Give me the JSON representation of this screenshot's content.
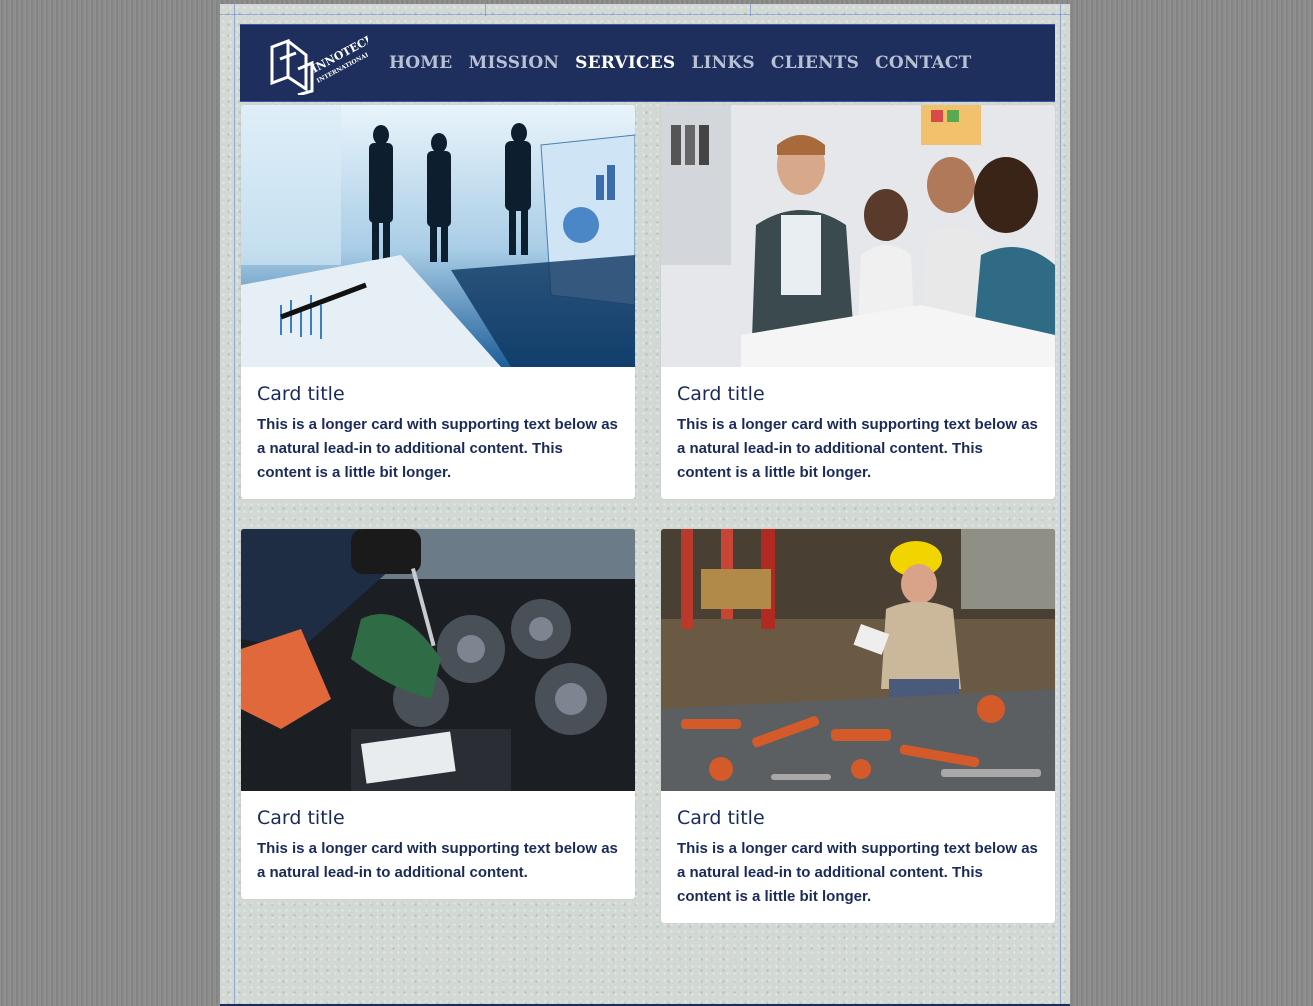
{
  "brand": {
    "logo_text": "INNOTECH",
    "logo_subtext": "INTERNATIONAL, LLC"
  },
  "nav": {
    "items": [
      {
        "label": "HOME",
        "active": false
      },
      {
        "label": "MISSION",
        "active": false
      },
      {
        "label": "SERVICES",
        "active": true
      },
      {
        "label": "LINKS",
        "active": false
      },
      {
        "label": "CLIENTS",
        "active": false
      },
      {
        "label": "CONTACT",
        "active": false
      }
    ]
  },
  "cards": [
    {
      "image": "business-meeting-photo",
      "title": "Card title",
      "text": "This is a longer card with supporting text below as a natural lead-in to additional content. This content is a little bit longer."
    },
    {
      "image": "team-discussion-photo",
      "title": "Card title",
      "text": "This is a longer card with supporting text below as a natural lead-in to additional content. This content is a little bit longer."
    },
    {
      "image": "engine-repair-photo",
      "title": "Card title",
      "text": "This is a longer card with supporting text below as a natural lead-in to additional content."
    },
    {
      "image": "industrial-worker-photo",
      "title": "Card title",
      "text": "This is a longer card with supporting text below as a natural lead-in to additional content. This content is a little bit longer."
    }
  ],
  "colors": {
    "navbar": "#1e2f5e",
    "text": "#1a2a5a",
    "nav_inactive": "#b8c0d4",
    "nav_active": "#ffffff"
  }
}
